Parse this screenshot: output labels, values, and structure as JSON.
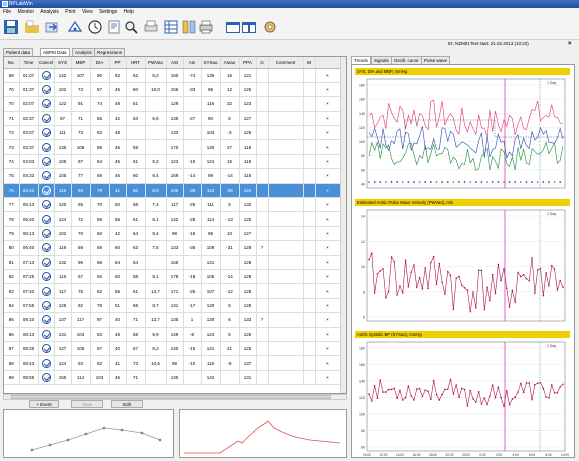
{
  "app": {
    "title": "BPLabWin"
  },
  "menu": [
    "File",
    "Monitor",
    "Analysis",
    "Print",
    "View",
    "Settings",
    "Help"
  ],
  "info": {
    "patient_id": "ID:",
    "patient_code": "NZM01",
    "test_start": "Test start: 21.02.2013 (10:23)"
  },
  "left_tabs": [
    "Patient data",
    "ABPM Data",
    "Analysis",
    "Regressions"
  ],
  "right_tabs": [
    "Trends",
    "Signals",
    "Oscill. curve",
    "Pulse wave"
  ],
  "table": {
    "columns": [
      "No.",
      "Time",
      "Cancel",
      "SYS",
      "MBP",
      "DIA",
      "PP",
      "HRT",
      "PWVao",
      "ASI",
      "AIx",
      "SYSao",
      "AIxao",
      "PPA",
      "G",
      "Comment",
      "W",
      ""
    ],
    "rows": [
      [
        "69",
        "01:07",
        "",
        "142",
        "107",
        "90",
        "52",
        "62",
        "8,2",
        "150",
        "-74",
        "136",
        "16",
        "121",
        "",
        "",
        "",
        "×"
      ],
      [
        "70",
        "01:37",
        "",
        "102",
        "73",
        "57",
        "45",
        "60",
        "10,0",
        "156",
        "-33",
        "95",
        "12",
        "125",
        "",
        "",
        "",
        "×"
      ],
      [
        "70",
        "02:07",
        "",
        "122",
        "91",
        "74",
        "48",
        "61",
        "",
        "129",
        "",
        "116",
        "32",
        "123",
        "",
        "",
        "",
        "×"
      ],
      [
        "71",
        "02:37",
        "",
        "97",
        "71",
        "55",
        "42",
        "63",
        "6,6",
        "135",
        "-27",
        "90",
        "6",
        "127",
        "",
        "",
        "",
        "×"
      ],
      [
        "72",
        "03:07",
        "",
        "111",
        "73",
        "63",
        "48",
        "",
        "",
        "133",
        "",
        "103",
        "-3",
        "126",
        "",
        "",
        "",
        "×"
      ],
      [
        "73",
        "03:37",
        "",
        "135",
        "108",
        "89",
        "46",
        "59",
        "",
        "170",
        "",
        "130",
        "27",
        "118",
        "",
        "",
        "",
        "×"
      ],
      [
        "74",
        "04:03",
        "",
        "105",
        "97",
        "84",
        "45",
        "61",
        "9,2",
        "123",
        "-10",
        "124",
        "15",
        "118",
        "",
        "",
        "",
        "×"
      ],
      [
        "75",
        "04:33",
        "",
        "105",
        "77",
        "59",
        "46",
        "60",
        "8,4",
        "159",
        "-14",
        "99",
        "-14",
        "118",
        "",
        "",
        "",
        "×"
      ],
      [
        "76",
        "04:43",
        "",
        "119",
        "94",
        "79",
        "41",
        "60",
        "8,9",
        "105",
        "-39",
        "113",
        "-39",
        "124",
        "",
        "",
        "",
        "×"
      ],
      [
        "77",
        "05:13",
        "",
        "120",
        "95",
        "70",
        "50",
        "68",
        "7,4",
        "117",
        "-26",
        "111",
        "5",
        "132",
        "",
        "",
        "",
        "×"
      ],
      [
        "78",
        "05:40",
        "",
        "124",
        "72",
        "59",
        "65",
        "61",
        "8,1",
        "142",
        "-28",
        "114",
        "-13",
        "125",
        "",
        "",
        "",
        "×"
      ],
      [
        "79",
        "06:13",
        "",
        "102",
        "70",
        "60",
        "42",
        "64",
        "9,4",
        "98",
        "-16",
        "95",
        "10",
        "127",
        "",
        "",
        "",
        "×"
      ],
      [
        "80",
        "06:40",
        "",
        "119",
        "69",
        "59",
        "60",
        "63",
        "7,5",
        "133",
        "-36",
        "109",
        "-31",
        "128",
        "?",
        "",
        "",
        "×"
      ],
      [
        "81",
        "07:13",
        "",
        "132",
        "96",
        "68",
        "64",
        "64",
        "",
        "166",
        "",
        "121",
        "",
        "128",
        "",
        "",
        "",
        "×"
      ],
      [
        "82",
        "07:25",
        "",
        "116",
        "67",
        "56",
        "60",
        "58",
        "8,1",
        "178",
        "-18",
        "105",
        "-14",
        "128",
        "",
        "",
        "",
        "×"
      ],
      [
        "83",
        "07:40",
        "",
        "117",
        "75",
        "62",
        "55",
        "61",
        "13,7",
        "171",
        "-26",
        "107",
        "-12",
        "128",
        "",
        "",
        "",
        "×"
      ],
      [
        "84",
        "07:55",
        "",
        "129",
        "92",
        "78",
        "51",
        "68",
        "8,7",
        "131",
        "-17",
        "120",
        "5",
        "128",
        "",
        "",
        "",
        "×"
      ],
      [
        "85",
        "08:10",
        "",
        "137",
        "117",
        "97",
        "40",
        "71",
        "13,7",
        "135",
        "1",
        "130",
        "6",
        "133",
        "?",
        "",
        "",
        "×"
      ],
      [
        "86",
        "08:13",
        "",
        "131",
        "104",
        "83",
        "48",
        "68",
        "9,9",
        "149",
        "-8",
        "124",
        "5",
        "126",
        "",
        "",
        "",
        "×"
      ],
      [
        "87",
        "08:28",
        "",
        "127",
        "105",
        "87",
        "40",
        "67",
        "8,2",
        "140",
        "-15",
        "121",
        "21",
        "125",
        "",
        "",
        "",
        "×"
      ],
      [
        "88",
        "08:43",
        "",
        "124",
        "93",
        "83",
        "41",
        "73",
        "10,6",
        "99",
        "-10",
        "116",
        "-8",
        "137",
        "",
        "",
        "",
        "×"
      ],
      [
        "89",
        "08:58",
        "",
        "150",
        "114",
        "104",
        "46",
        "71",
        "",
        "130",
        "",
        "142",
        "",
        "131",
        "",
        "",
        "",
        "×"
      ]
    ]
  },
  "buttons": {
    "add_event": "+ Event",
    "save": "Save",
    "edit": "Edit"
  },
  "charts": {
    "trend_title": "SYS, DIA and MBP, mmHg",
    "pwv_title": "Estimated Aortic Pulse Wave Velocity (PWVao), m/s",
    "sysao_title": "Aortic Systolic BP (SYSao), mmHg",
    "day_label": "1 Day",
    "trend_y": [
      "180",
      "160",
      "140",
      "120",
      "100",
      "80",
      "60",
      "40"
    ],
    "pwv_y": [
      "14",
      "12",
      "10",
      "8",
      "6"
    ],
    "sysao_y": [
      "180",
      "160",
      "140",
      "120",
      "100",
      "80",
      "60"
    ],
    "x_ticks": [
      "10:00",
      "12:00",
      "14:00",
      "16:00",
      "18:00",
      "20:00",
      "22:00",
      "0:00",
      "2:00",
      "4:00",
      "6:00",
      "8:00",
      "10:00"
    ]
  },
  "colors": {
    "selected_row": "#4a90d9",
    "chart_header": "#f1d000",
    "sys_line": "#e0327c",
    "dia_line": "#1d8a3a",
    "mbp_line": "#2747b8",
    "marker": "#e83ab0"
  }
}
